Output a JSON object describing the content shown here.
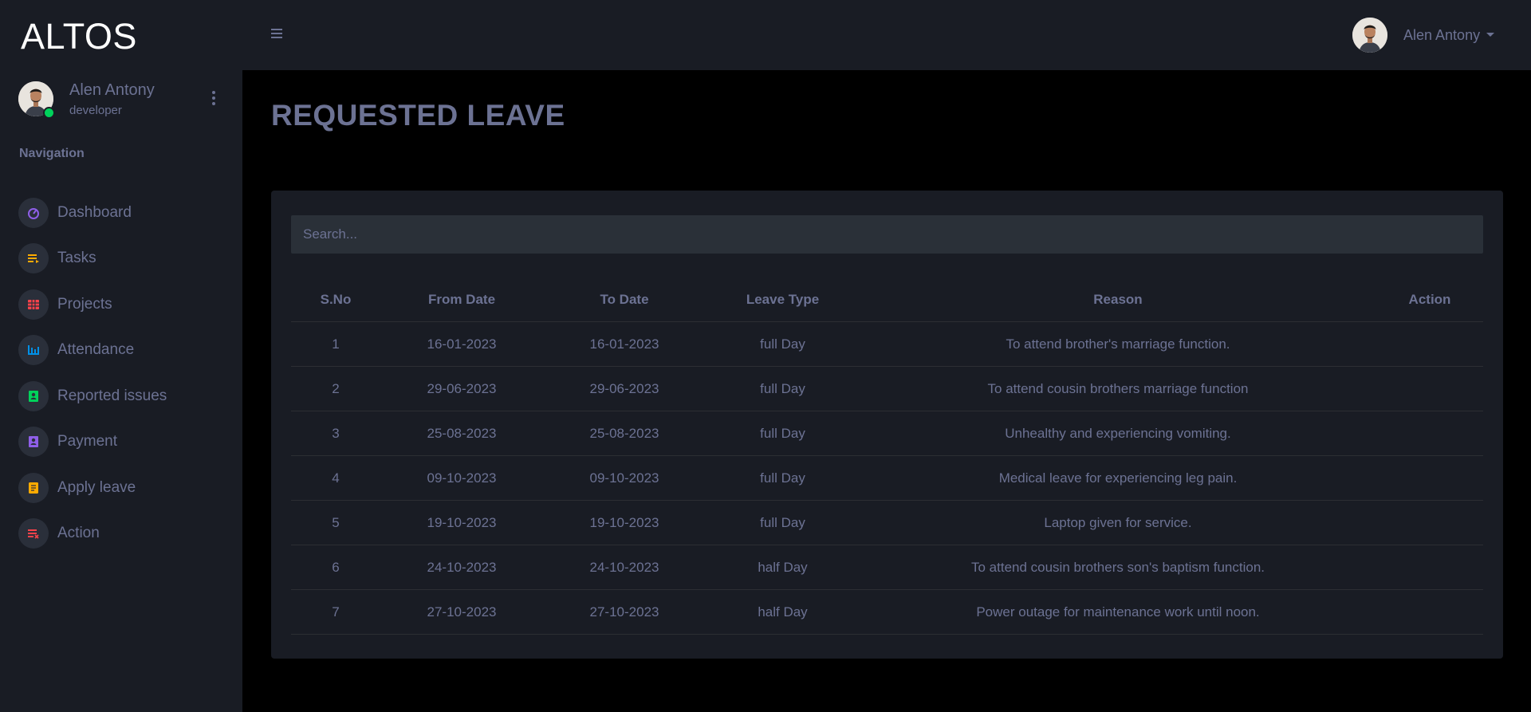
{
  "app": {
    "brand": "ALTOS"
  },
  "profile": {
    "name": "Alen Antony",
    "role": "developer",
    "online_color": "#00d25b"
  },
  "sidebar": {
    "heading": "Navigation",
    "items": [
      {
        "label": "Dashboard",
        "icon": "speedometer-icon",
        "color": "#8f5fe8"
      },
      {
        "label": "Tasks",
        "icon": "playlist-icon",
        "color": "#ffab00"
      },
      {
        "label": "Projects",
        "icon": "table-icon",
        "color": "#fc424a"
      },
      {
        "label": "Attendance",
        "icon": "bar-chart-icon",
        "color": "#0090e7"
      },
      {
        "label": "Reported issues",
        "icon": "contact-card-icon",
        "color": "#00d25b"
      },
      {
        "label": "Payment",
        "icon": "contact-card-icon",
        "color": "#8f5fe8"
      },
      {
        "label": "Apply leave",
        "icon": "document-icon",
        "color": "#ffab00"
      },
      {
        "label": "Action",
        "icon": "playlist-remove-icon",
        "color": "#fc424a"
      }
    ]
  },
  "topbar": {
    "user_name": "Alen Antony"
  },
  "page": {
    "title": "REQUESTED LEAVE"
  },
  "search": {
    "placeholder": "Search..."
  },
  "table": {
    "headers": [
      "S.No",
      "From Date",
      "To Date",
      "Leave Type",
      "Reason",
      "Action"
    ],
    "rows": [
      [
        "1",
        "16-01-2023",
        "16-01-2023",
        "full Day",
        "To attend brother's marriage function.",
        ""
      ],
      [
        "2",
        "29-06-2023",
        "29-06-2023",
        "full Day",
        "To attend cousin brothers marriage function",
        ""
      ],
      [
        "3",
        "25-08-2023",
        "25-08-2023",
        "full Day",
        "Unhealthy and experiencing vomiting.",
        ""
      ],
      [
        "4",
        "09-10-2023",
        "09-10-2023",
        "full Day",
        "Medical leave for experiencing leg pain.",
        ""
      ],
      [
        "5",
        "19-10-2023",
        "19-10-2023",
        "full Day",
        "Laptop given for service.",
        ""
      ],
      [
        "6",
        "24-10-2023",
        "24-10-2023",
        "half Day",
        "To attend cousin brothers son's baptism function.",
        ""
      ],
      [
        "7",
        "27-10-2023",
        "27-10-2023",
        "half Day",
        "Power outage for maintenance work until noon.",
        ""
      ]
    ]
  }
}
